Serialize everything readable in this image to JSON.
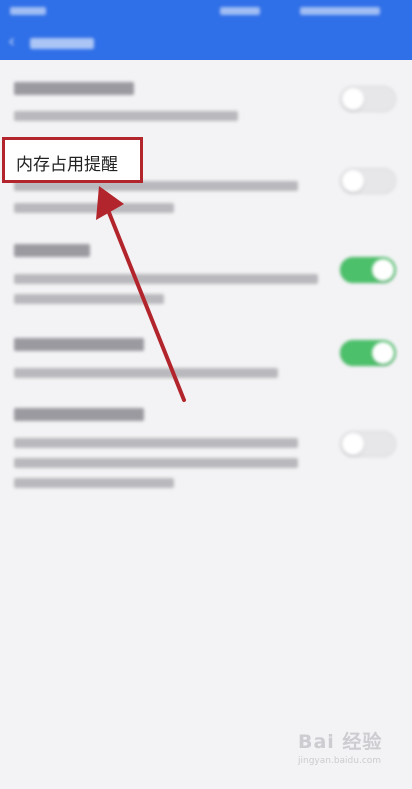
{
  "highlight": {
    "label": "内存占用提醒"
  },
  "toggles": [
    {
      "on": false
    },
    {
      "on": false
    },
    {
      "on": true
    },
    {
      "on": true
    },
    {
      "on": false
    }
  ],
  "watermark": {
    "logo": "Bai 经验",
    "url": "jingyan.baidu.com"
  },
  "colors": {
    "appbar": "#2f6fe8",
    "toggle_on": "#4cc06a",
    "highlight": "#b3252c"
  }
}
